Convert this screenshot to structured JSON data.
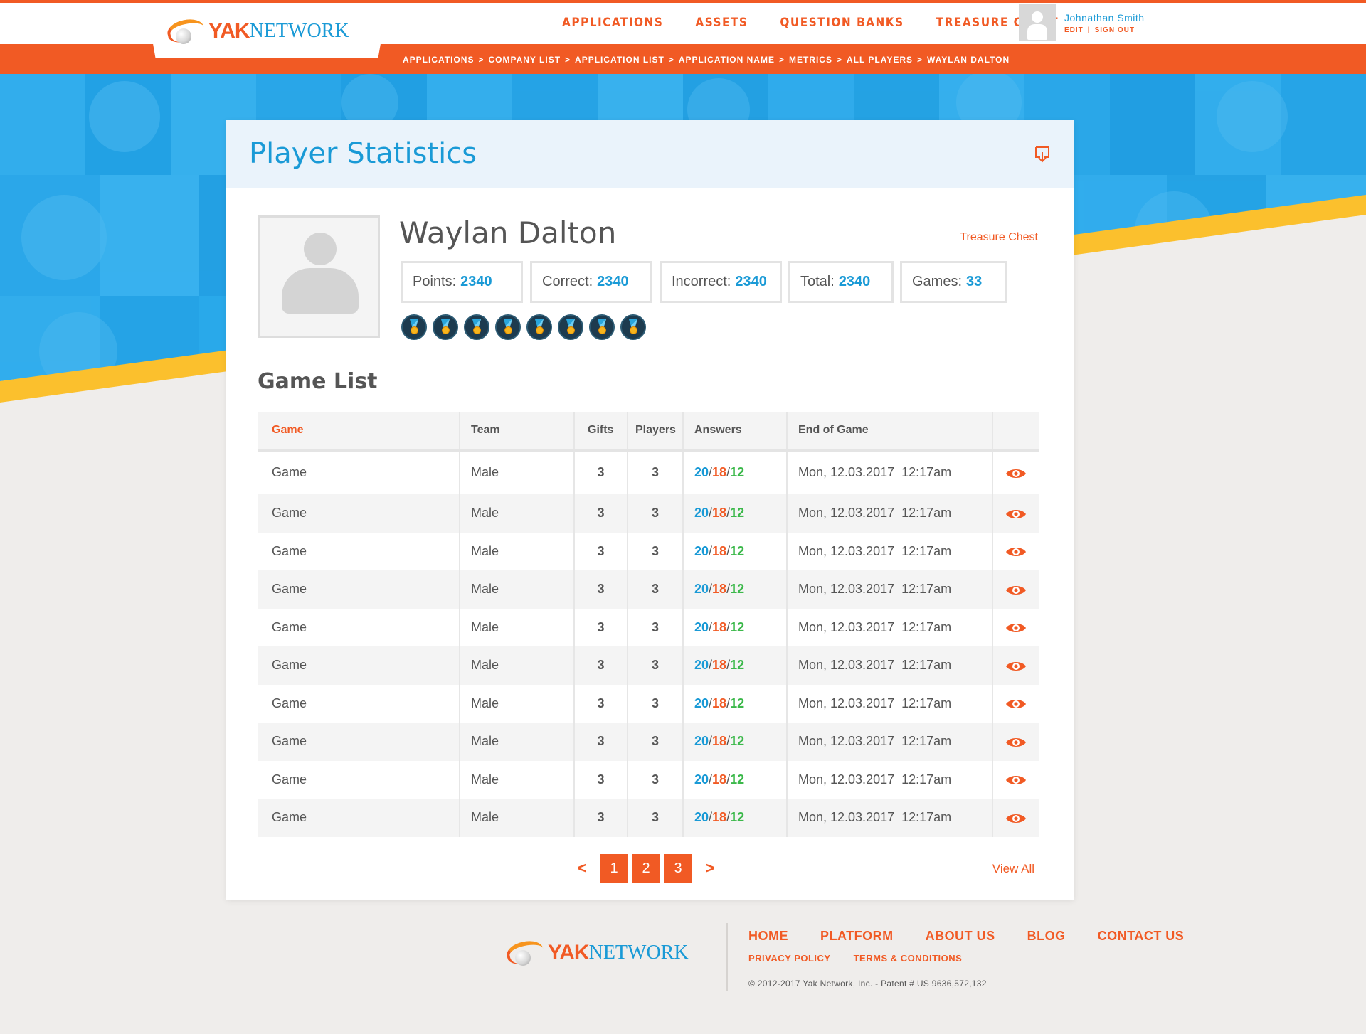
{
  "brand": {
    "logo_yak": "YAK",
    "logo_network": "NETWORK"
  },
  "nav": {
    "items": [
      "APPLICATIONS",
      "ASSETS",
      "QUESTION BANKS",
      "TREASURE CHEST"
    ]
  },
  "user": {
    "name": "Johnathan Smith",
    "edit": "EDIT",
    "separator": "|",
    "signout": "SIGN OUT"
  },
  "breadcrumb": [
    "APPLICATIONS",
    "COMPANY LIST",
    "APPLICATION LIST",
    "APPLICATION NAME",
    "METRICS",
    "ALL PLAYERS",
    "WAYLAN DALTON"
  ],
  "breadcrumb_separator": ">",
  "page": {
    "title": "Player Statistics"
  },
  "player": {
    "name": "Waylan Dalton",
    "treasure_link": "Treasure Chest",
    "stats": [
      {
        "label": "Points:",
        "value": "2340"
      },
      {
        "label": "Correct:",
        "value": "2340"
      },
      {
        "label": "Incorrect:",
        "value": "2340"
      },
      {
        "label": "Total:",
        "value": "2340"
      },
      {
        "label": "Games:",
        "value": "33"
      }
    ],
    "badge_count": 8,
    "badge_icon": "medal-icon"
  },
  "game_list": {
    "title": "Game List",
    "columns": [
      "Game",
      "Team",
      "Gifts",
      "Players",
      "Answers",
      "End of Game",
      ""
    ],
    "sorted_column": "Game",
    "rows": [
      {
        "game": "Game",
        "team": "Male",
        "gifts": "3",
        "players": "3",
        "answers": [
          "20",
          "18",
          "12"
        ],
        "end": "Mon, 12.03.2017  12:17am"
      },
      {
        "game": "Game",
        "team": "Male",
        "gifts": "3",
        "players": "3",
        "answers": [
          "20",
          "18",
          "12"
        ],
        "end": "Mon, 12.03.2017  12:17am"
      },
      {
        "game": "Game",
        "team": "Male",
        "gifts": "3",
        "players": "3",
        "answers": [
          "20",
          "18",
          "12"
        ],
        "end": "Mon, 12.03.2017  12:17am"
      },
      {
        "game": "Game",
        "team": "Male",
        "gifts": "3",
        "players": "3",
        "answers": [
          "20",
          "18",
          "12"
        ],
        "end": "Mon, 12.03.2017  12:17am"
      },
      {
        "game": "Game",
        "team": "Male",
        "gifts": "3",
        "players": "3",
        "answers": [
          "20",
          "18",
          "12"
        ],
        "end": "Mon, 12.03.2017  12:17am"
      },
      {
        "game": "Game",
        "team": "Male",
        "gifts": "3",
        "players": "3",
        "answers": [
          "20",
          "18",
          "12"
        ],
        "end": "Mon, 12.03.2017  12:17am"
      },
      {
        "game": "Game",
        "team": "Male",
        "gifts": "3",
        "players": "3",
        "answers": [
          "20",
          "18",
          "12"
        ],
        "end": "Mon, 12.03.2017  12:17am"
      },
      {
        "game": "Game",
        "team": "Male",
        "gifts": "3",
        "players": "3",
        "answers": [
          "20",
          "18",
          "12"
        ],
        "end": "Mon, 12.03.2017  12:17am"
      },
      {
        "game": "Game",
        "team": "Male",
        "gifts": "3",
        "players": "3",
        "answers": [
          "20",
          "18",
          "12"
        ],
        "end": "Mon, 12.03.2017  12:17am"
      },
      {
        "game": "Game",
        "team": "Male",
        "gifts": "3",
        "players": "3",
        "answers": [
          "20",
          "18",
          "12"
        ],
        "end": "Mon, 12.03.2017  12:17am"
      }
    ],
    "row_action_icon": "eye-icon"
  },
  "pagination": {
    "prev": "<",
    "pages": [
      "1",
      "2",
      "3"
    ],
    "next": ">",
    "view_all": "View All"
  },
  "footer": {
    "nav": [
      "HOME",
      "PLATFORM",
      "ABOUT US",
      "BLOG",
      "CONTACT US"
    ],
    "links": [
      "PRIVACY POLICY",
      "TERMS & CONDITIONS"
    ],
    "copyright": "© 2012-2017 Yak Network, Inc. - Patent # US 9636,572,132"
  },
  "colors": {
    "accent_orange": "#f15a24",
    "accent_blue": "#1a9ad6",
    "accent_green": "#3bb84a",
    "hero_yellow": "#fbc02d"
  }
}
